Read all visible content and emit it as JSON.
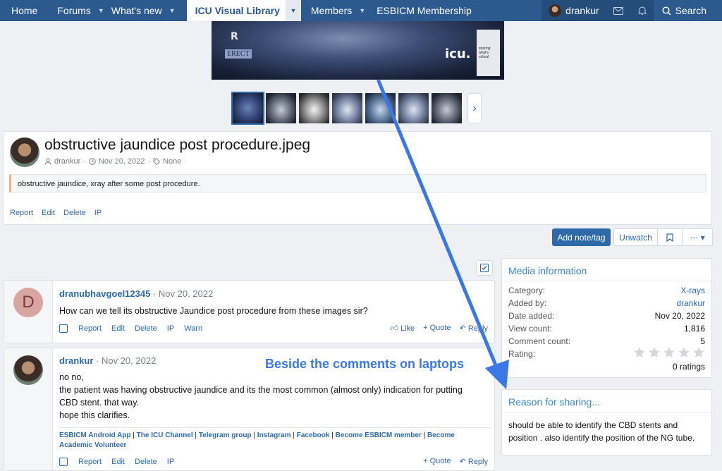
{
  "nav": {
    "items": [
      {
        "label": "Home"
      },
      {
        "label": "Forums"
      },
      {
        "label": "What's new"
      },
      {
        "label": "ICU Visual Library"
      },
      {
        "label": "Members"
      },
      {
        "label": "ESBICM Membership"
      }
    ],
    "user": "drankur",
    "search_label": "Search"
  },
  "hero": {
    "marker_r": "R",
    "marker_erect": "ERECT",
    "logo": "icu.",
    "card_text": "sharing what's critical"
  },
  "media": {
    "title": "obstructive jaundice post procedure.jpeg",
    "author": "drankur",
    "date": "Nov 20, 2022",
    "tags": "None",
    "description": "obstructive jaundice, xray after some post procedure.",
    "actions": [
      "Report",
      "Edit",
      "Delete",
      "IP"
    ]
  },
  "toolbar": {
    "add_note": "Add note/tag",
    "unwatch": "Unwatch",
    "more": "⋯ ▾"
  },
  "comments": [
    {
      "author": "dranubhavgoel12345",
      "date": "Nov 20, 2022",
      "avatar_letter": "D",
      "body": "How can we tell its obstructive Jaundice post procedure from these images sir?",
      "actions": [
        "Report",
        "Edit",
        "Delete",
        "IP",
        "Warn"
      ],
      "like": "Like",
      "quote": "Quote",
      "reply": "Reply"
    },
    {
      "author": "drankur",
      "date": "Nov 20, 2022",
      "body_lines": [
        "no no,",
        "the patient was having obstructive jaundice and its the most common (almost only) indication for putting",
        "CBD stent. that way.",
        "hope this clarifies."
      ],
      "signature": [
        "ESBICM Android App",
        "The ICU Channel",
        "Telegram group",
        "Instagram",
        "Facebook",
        "Become ESBICM member",
        "Become",
        "Academic Volunteer"
      ],
      "actions": [
        "Report",
        "Edit",
        "Delete",
        "IP"
      ],
      "quote": "Quote",
      "reply": "Reply"
    }
  ],
  "sidebar": {
    "media_info": {
      "title": "Media information",
      "rows": [
        {
          "label": "Category:",
          "value": "X-rays"
        },
        {
          "label": "Added by:",
          "value": "drankur"
        },
        {
          "label": "Date added:",
          "value": "Nov 20, 2022"
        },
        {
          "label": "View count:",
          "value": "1,816"
        },
        {
          "label": "Comment count:",
          "value": "5"
        },
        {
          "label": "Rating:",
          "value": ""
        }
      ],
      "rating_text": "0 ratings"
    },
    "reason": {
      "title": "Reason for sharing...",
      "text": "should be able to identify the CBD stents and position . also identify the position of the NG tube."
    }
  },
  "annotation": {
    "text": "Beside the comments on laptops",
    "color": "#3b78e7"
  }
}
